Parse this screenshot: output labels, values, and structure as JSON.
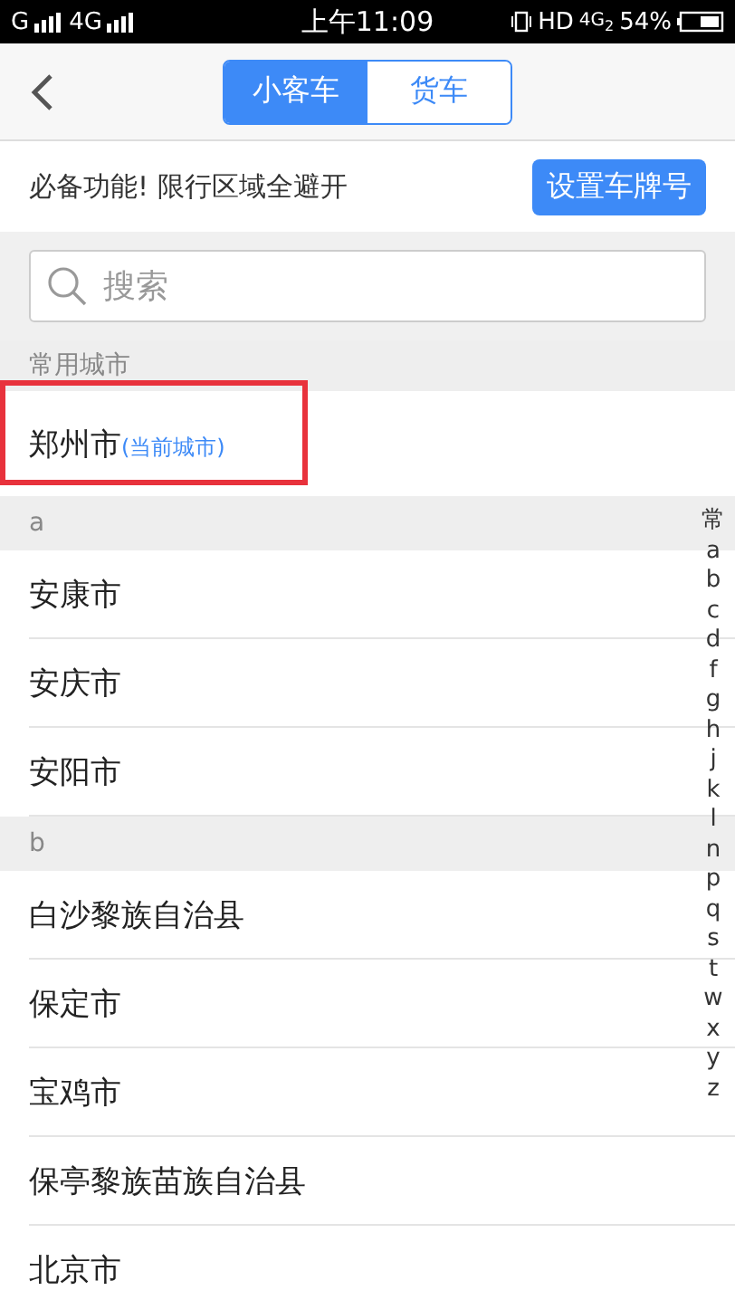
{
  "status_bar": {
    "carrier_1": "G",
    "carrier_2": "4G",
    "time": "上午11:09",
    "hd": "HD",
    "network": "4G$_{2}$",
    "battery": "54%"
  },
  "header": {
    "tabs": [
      {
        "label": "小客车",
        "selected": true
      },
      {
        "label": "货车",
        "selected": false
      }
    ]
  },
  "banner": {
    "text": "必备功能! 限行区域全避开",
    "button": "设置车牌号"
  },
  "search": {
    "placeholder": "搜索"
  },
  "sections": [
    {
      "title": "常用城市",
      "cities": [
        {
          "name": "郑州市",
          "note": "(当前城市)",
          "highlighted": true
        }
      ]
    },
    {
      "title": "a",
      "cities": [
        {
          "name": "安康市",
          "highlighted": false
        },
        {
          "name": "安庆市",
          "highlighted": false
        },
        {
          "name": "安阳市",
          "highlighted": false
        }
      ]
    },
    {
      "title": "b",
      "cities": [
        {
          "name": "白沙黎族自治县",
          "highlighted": false
        },
        {
          "name": "保定市",
          "highlighted": false
        },
        {
          "name": "宝鸡市",
          "highlighted": false
        },
        {
          "name": "保亭黎族苗族自治县",
          "highlighted": false
        },
        {
          "name": "北京市",
          "highlighted": false
        }
      ]
    }
  ],
  "index_bar": [
    "常",
    "a",
    "b",
    "c",
    "d",
    "f",
    "g",
    "h",
    "j",
    "k",
    "l",
    "n",
    "p",
    "q",
    "s",
    "t",
    "w",
    "x",
    "y",
    "z"
  ]
}
